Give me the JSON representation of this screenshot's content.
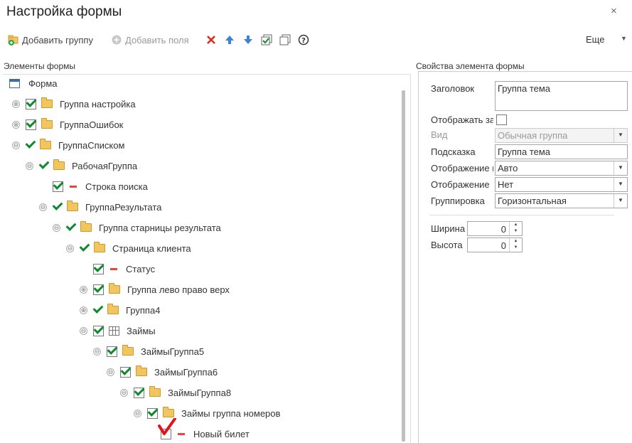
{
  "window": {
    "title": "Настройка формы",
    "close_glyph": "×"
  },
  "toolbar": {
    "add_group": "Добавить группу",
    "add_field": "Добавить поля",
    "more": "Еще",
    "more_arrow": "▼"
  },
  "left": {
    "section_title": "Элементы формы"
  },
  "right": {
    "section_title": "Свойства элемента формы"
  },
  "tree": {
    "rows": [
      {
        "text": "Форма",
        "icon": "form-icon",
        "expander": "",
        "check": "none"
      },
      {
        "text": "Группа настройка",
        "icon": "folder-icon",
        "expander": "⊕",
        "check": "box"
      },
      {
        "text": "ГруппаОшибок",
        "icon": "folder-icon",
        "expander": "⊕",
        "check": "box"
      },
      {
        "text": "ГруппаСписком",
        "icon": "folder-icon",
        "expander": "⊖",
        "check": "tick"
      },
      {
        "text": "РабочаяГруппа",
        "icon": "folder-icon",
        "expander": "⊖",
        "check": "tick"
      },
      {
        "text": "Строка поиска",
        "icon": "field-icon",
        "expander": "",
        "check": "box"
      },
      {
        "text": "ГруппаРезультата",
        "icon": "folder-icon",
        "expander": "⊖",
        "check": "tick"
      },
      {
        "text": "Группа старницы результата",
        "icon": "folder-icon",
        "expander": "⊖",
        "check": "tick"
      },
      {
        "text": "Страница клиента",
        "icon": "folder-icon",
        "expander": "⊖",
        "check": "tick"
      },
      {
        "text": "Статус",
        "icon": "field-icon",
        "expander": "",
        "check": "box"
      },
      {
        "text": "Группа лево право верх",
        "icon": "folder-icon",
        "expander": "⊕",
        "check": "box"
      },
      {
        "text": "Группа4",
        "icon": "folder-icon",
        "expander": "⊕",
        "check": "tick"
      },
      {
        "text": "Займы",
        "icon": "table-icon",
        "expander": "⊖",
        "check": "box"
      },
      {
        "text": "ЗаймыГруппа5",
        "icon": "folder-icon",
        "expander": "⊖",
        "check": "box"
      },
      {
        "text": "ЗаймыГруппа6",
        "icon": "folder-icon",
        "expander": "⊖",
        "check": "box"
      },
      {
        "text": "ЗаймыГруппа8",
        "icon": "folder-icon",
        "expander": "⊖",
        "check": "box"
      },
      {
        "text": "Займы группа номеров",
        "icon": "folder-icon",
        "expander": "⊖",
        "check": "box"
      },
      {
        "text": "Новый билет",
        "icon": "field-icon",
        "expander": "",
        "check": "box-off"
      }
    ]
  },
  "props": {
    "title_label": "Заголовок",
    "title_value": "Группа тема",
    "show_title_label": "Отображать за",
    "view_label": "Вид",
    "view_value": "Обычная группа",
    "tooltip_label": "Подсказка",
    "tooltip_value": "Группа тема",
    "display1_label": "Отображение г",
    "display1_value": "Авто",
    "display2_label": "Отображение",
    "display2_value": "Нет",
    "grouping_label": "Группировка",
    "grouping_value": "Горизонтальная",
    "width_label": "Ширина",
    "width_value": "0",
    "height_label": "Высота",
    "height_value": "0",
    "dd_arrow": "▼",
    "spin_up": "▲",
    "spin_down": "▼"
  },
  "colors": {
    "check": "#0f8a2e",
    "folder": "#f1c560",
    "field_marker": "#e5473a",
    "annotation": "#e0141c"
  }
}
